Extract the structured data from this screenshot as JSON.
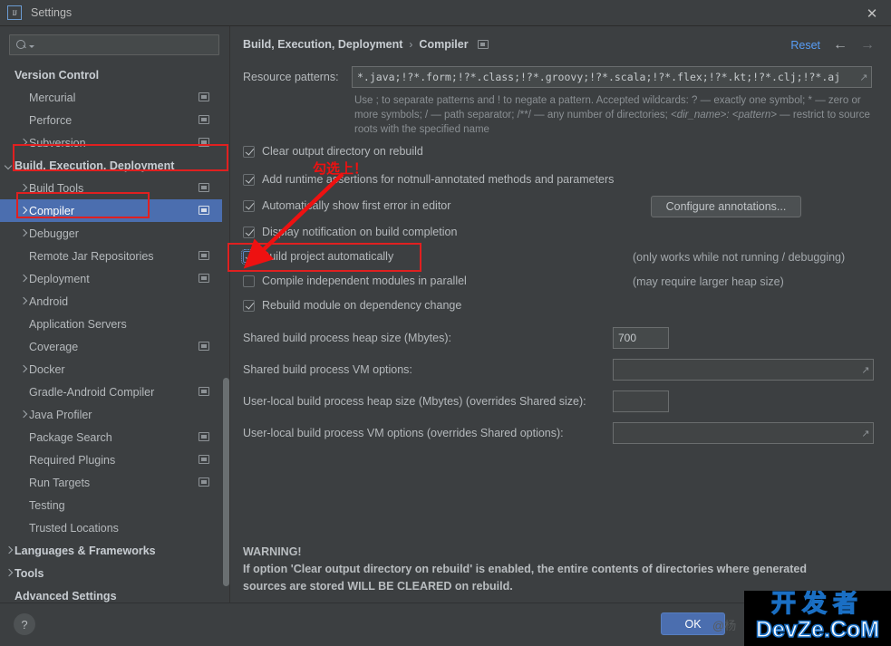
{
  "window": {
    "title": "Settings",
    "logo_text": "IJ",
    "close_icon": "✕"
  },
  "sidebar": {
    "search": {
      "value": "",
      "placeholder": ""
    },
    "items": [
      {
        "label": "Version Control",
        "indent": 0,
        "bold": true,
        "arrow": "none",
        "scope": false,
        "selected": false
      },
      {
        "label": "Mercurial",
        "indent": 1,
        "bold": false,
        "arrow": "none",
        "scope": true,
        "selected": false
      },
      {
        "label": "Perforce",
        "indent": 1,
        "bold": false,
        "arrow": "none",
        "scope": true,
        "selected": false
      },
      {
        "label": "Subversion",
        "indent": 1,
        "bold": false,
        "arrow": "right",
        "scope": true,
        "selected": false
      },
      {
        "label": "Build, Execution, Deployment",
        "indent": 0,
        "bold": true,
        "arrow": "down",
        "scope": false,
        "selected": false
      },
      {
        "label": "Build Tools",
        "indent": 1,
        "bold": false,
        "arrow": "right",
        "scope": true,
        "selected": false
      },
      {
        "label": "Compiler",
        "indent": 1,
        "bold": false,
        "arrow": "right",
        "scope": true,
        "selected": true
      },
      {
        "label": "Debugger",
        "indent": 1,
        "bold": false,
        "arrow": "right",
        "scope": false,
        "selected": false
      },
      {
        "label": "Remote Jar Repositories",
        "indent": 1,
        "bold": false,
        "arrow": "none",
        "scope": true,
        "selected": false
      },
      {
        "label": "Deployment",
        "indent": 1,
        "bold": false,
        "arrow": "right",
        "scope": true,
        "selected": false
      },
      {
        "label": "Android",
        "indent": 1,
        "bold": false,
        "arrow": "right",
        "scope": false,
        "selected": false
      },
      {
        "label": "Application Servers",
        "indent": 1,
        "bold": false,
        "arrow": "none",
        "scope": false,
        "selected": false
      },
      {
        "label": "Coverage",
        "indent": 1,
        "bold": false,
        "arrow": "none",
        "scope": true,
        "selected": false
      },
      {
        "label": "Docker",
        "indent": 1,
        "bold": false,
        "arrow": "right",
        "scope": false,
        "selected": false
      },
      {
        "label": "Gradle-Android Compiler",
        "indent": 1,
        "bold": false,
        "arrow": "none",
        "scope": true,
        "selected": false
      },
      {
        "label": "Java Profiler",
        "indent": 1,
        "bold": false,
        "arrow": "right",
        "scope": false,
        "selected": false
      },
      {
        "label": "Package Search",
        "indent": 1,
        "bold": false,
        "arrow": "none",
        "scope": true,
        "selected": false
      },
      {
        "label": "Required Plugins",
        "indent": 1,
        "bold": false,
        "arrow": "none",
        "scope": true,
        "selected": false
      },
      {
        "label": "Run Targets",
        "indent": 1,
        "bold": false,
        "arrow": "none",
        "scope": true,
        "selected": false
      },
      {
        "label": "Testing",
        "indent": 1,
        "bold": false,
        "arrow": "none",
        "scope": false,
        "selected": false
      },
      {
        "label": "Trusted Locations",
        "indent": 1,
        "bold": false,
        "arrow": "none",
        "scope": false,
        "selected": false
      },
      {
        "label": "Languages & Frameworks",
        "indent": 0,
        "bold": true,
        "arrow": "right",
        "scope": false,
        "selected": false
      },
      {
        "label": "Tools",
        "indent": 0,
        "bold": true,
        "arrow": "right",
        "scope": false,
        "selected": false
      },
      {
        "label": "Advanced Settings",
        "indent": 0,
        "bold": true,
        "arrow": "none",
        "scope": false,
        "selected": false
      }
    ]
  },
  "header": {
    "breadcrumb_root": "Build, Execution, Deployment",
    "breadcrumb_sep": "›",
    "breadcrumb_leaf": "Compiler",
    "reset_label": "Reset",
    "back_icon": "←",
    "forward_icon": "→"
  },
  "main": {
    "resource_patterns_label": "Resource patterns:",
    "resource_patterns_value": "*.java;!?*.form;!?*.class;!?*.groovy;!?*.scala;!?*.flex;!?*.kt;!?*.clj;!?*.aj",
    "hint_line1": "Use ; to separate patterns and ! to negate a pattern. Accepted wildcards: ? — exactly one symbol; * — zero",
    "hint_line2a": "or more symbols; / — path separator; /**/ — any number of directories; ",
    "hint_line2b": "<dir_name>: <pattern>",
    "hint_line2c": " — restrict to",
    "hint_line3": "source roots with the specified name",
    "checkboxes": [
      {
        "label": "Clear output directory on rebuild",
        "checked": true,
        "focused": false,
        "note": ""
      },
      {
        "label": "Add runtime assertions for notnull-annotated methods and parameters",
        "checked": true,
        "focused": false,
        "note": ""
      },
      {
        "label": "Automatically show first error in editor",
        "checked": true,
        "focused": false,
        "note": ""
      },
      {
        "label": "Display notification on build completion",
        "checked": true,
        "focused": false,
        "note": ""
      },
      {
        "label": "Build project automatically",
        "checked": true,
        "focused": true,
        "note": "(only works while not running / debugging)"
      },
      {
        "label": "Compile independent modules in parallel",
        "checked": false,
        "focused": false,
        "note": "(may require larger heap size)"
      },
      {
        "label": "Rebuild module on dependency change",
        "checked": true,
        "focused": false,
        "note": ""
      }
    ],
    "configure_annotations_label": "Configure annotations...",
    "fields": [
      {
        "label": "Shared build process heap size (Mbytes):",
        "value": "700"
      },
      {
        "label": "Shared build process VM options:",
        "value": ""
      },
      {
        "label": "User-local build process heap size (Mbytes) (overrides Shared size):",
        "value": ""
      },
      {
        "label": "User-local build process VM options (overrides Shared options):",
        "value": ""
      }
    ],
    "warning_title": "WARNING!",
    "warning_line1": "If option 'Clear output directory on rebuild' is enabled, the entire contents of directories where generated",
    "warning_line2": "sources are stored WILL BE CLEARED on rebuild."
  },
  "footer": {
    "help_label": "?",
    "ok_label": "OK"
  },
  "annotations": {
    "callout_text": "勾选上！"
  },
  "watermark": {
    "cn": "开发者",
    "en": "DevZe.CoM",
    "at_text": "@杨"
  },
  "colors": {
    "background": "#3c3f41",
    "selection": "#4b6eaf",
    "accent_link": "#589df6",
    "annotation_red": "#e02020",
    "watermark_blue": "#1a6fc4"
  }
}
